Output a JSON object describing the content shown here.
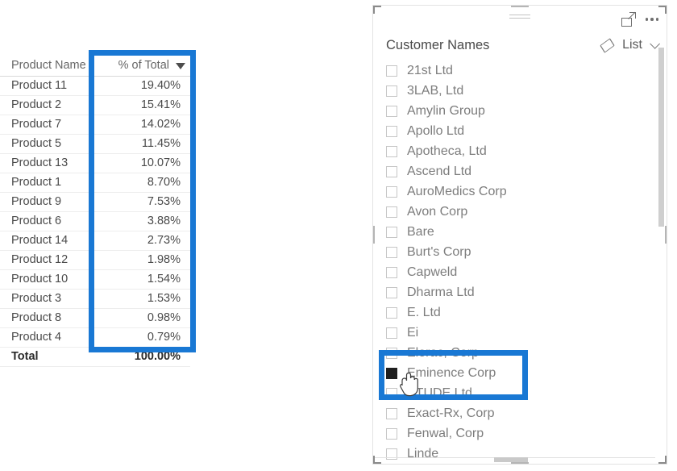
{
  "table_visual": {
    "name": "product-percent-table",
    "columns": [
      "Product Name",
      "% of Total"
    ],
    "sort_indicator": "sort-descending-icon",
    "rows": [
      {
        "product": "Product 11",
        "pct": "19.40%"
      },
      {
        "product": "Product 2",
        "pct": "15.41%"
      },
      {
        "product": "Product 7",
        "pct": "14.02%"
      },
      {
        "product": "Product 5",
        "pct": "11.45%"
      },
      {
        "product": "Product 13",
        "pct": "10.07%"
      },
      {
        "product": "Product 1",
        "pct": "8.70%"
      },
      {
        "product": "Product 9",
        "pct": "7.53%"
      },
      {
        "product": "Product 6",
        "pct": "3.88%"
      },
      {
        "product": "Product 14",
        "pct": "2.73%"
      },
      {
        "product": "Product 12",
        "pct": "1.98%"
      },
      {
        "product": "Product 10",
        "pct": "1.54%"
      },
      {
        "product": "Product 3",
        "pct": "1.53%"
      },
      {
        "product": "Product 8",
        "pct": "0.98%"
      },
      {
        "product": "Product 4",
        "pct": "0.79%"
      }
    ],
    "total_row": {
      "label": "Total",
      "pct": "100.00%"
    }
  },
  "slicer": {
    "title": "Customer Names",
    "mode_label": "List",
    "clear_icon": "eraser-icon",
    "dropdown_icon": "chevron-down-icon",
    "focus_icon": "focus-mode-icon",
    "more_icon": "more-options-icon",
    "drag_icon": "drag-handle-icon",
    "items": [
      {
        "label": "21st Ltd",
        "checked": false
      },
      {
        "label": "3LAB, Ltd",
        "checked": false
      },
      {
        "label": "Amylin Group",
        "checked": false
      },
      {
        "label": "Apollo Ltd",
        "checked": false
      },
      {
        "label": "Apotheca, Ltd",
        "checked": false
      },
      {
        "label": "Ascend Ltd",
        "checked": false
      },
      {
        "label": "AuroMedics Corp",
        "checked": false
      },
      {
        "label": "Avon Corp",
        "checked": false
      },
      {
        "label": "Bare",
        "checked": false
      },
      {
        "label": "Burt's Corp",
        "checked": false
      },
      {
        "label": "Capweld",
        "checked": false
      },
      {
        "label": "Dharma Ltd",
        "checked": false
      },
      {
        "label": "E. Ltd",
        "checked": false
      },
      {
        "label": "Ei",
        "checked": false
      },
      {
        "label": "Elorac, Corp",
        "checked": false
      },
      {
        "label": "Eminence Corp",
        "checked": true
      },
      {
        "label": "ETUDE Ltd",
        "checked": false
      },
      {
        "label": "Exact-Rx, Corp",
        "checked": false
      },
      {
        "label": "Fenwal, Corp",
        "checked": false
      },
      {
        "label": "Linde",
        "checked": false
      }
    ]
  },
  "annotations": {
    "color": "#1978D4",
    "table_box_name": "percent-of-total-highlight",
    "slicer_box_name": "eminence-corp-selection-highlight"
  },
  "cursor": {
    "type": "hand-pointer-cursor"
  }
}
